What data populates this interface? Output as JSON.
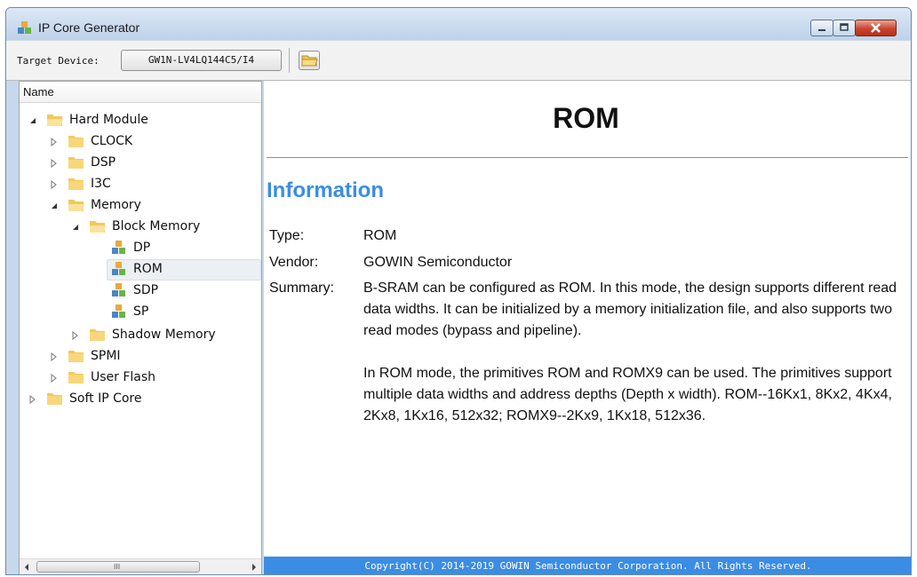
{
  "window": {
    "title": "IP Core Generator"
  },
  "toolbar": {
    "target_label": "Target Device:",
    "device_value": "GW1N-LV4LQ144C5/I4"
  },
  "tree": {
    "header": "Name",
    "nodes": {
      "hard_module": "Hard Module",
      "clock": "CLOCK",
      "dsp": "DSP",
      "i3c": "I3C",
      "memory": "Memory",
      "block_memory": "Block Memory",
      "dp": "DP",
      "rom": "ROM",
      "sdp": "SDP",
      "sp": "SP",
      "shadow_memory": "Shadow Memory",
      "spmi": "SPMI",
      "user_flash": "User Flash",
      "soft_ip_core": "Soft IP Core"
    },
    "selected": "ROM",
    "scroll_grip": "III"
  },
  "doc": {
    "title": "ROM",
    "section": "Information",
    "type_label": "Type:",
    "type_value": "ROM",
    "vendor_label": "Vendor:",
    "vendor_value": "GOWIN Semiconductor",
    "summary_label": "Summary:",
    "summary_p1": "B-SRAM can be configured as ROM. In this mode, the design supports different read data widths. It can be initialized by a memory initialization file, and also supports two read modes (bypass and pipeline).",
    "summary_p2": "In ROM mode, the primitives ROM and ROMX9 can be used. The primitives support multiple data widths and address depths (Depth x width). ROM--16Kx1, 8Kx2, 4Kx4, 2Kx8, 1Kx16, 512x32; ROMX9--2Kx9, 1Kx18, 512x36."
  },
  "footer": {
    "copyright": "Copyright(C) 2014-2019 GOWIN Semiconductor Corporation. All Rights Reserved."
  },
  "colors": {
    "accent": "#3a8de3",
    "folder": "#f3c85a",
    "close_button": "#c9452e"
  },
  "icons": {
    "app": "ip-core-cubes-icon",
    "folder": "folder-icon",
    "ip": "ip-core-cubes-icon"
  }
}
